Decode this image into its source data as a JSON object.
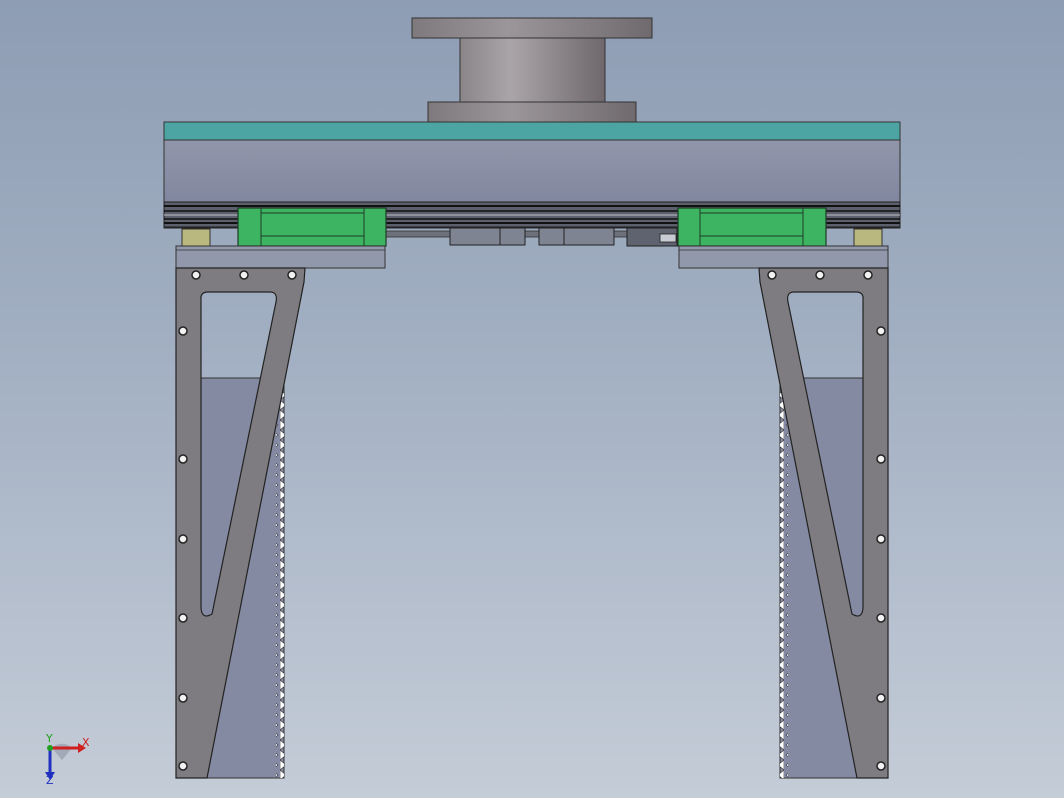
{
  "view": {
    "colors": {
      "background_top": "#8e9db4",
      "background_bottom": "#c4ccd7",
      "plate_teal": "#4da5a3",
      "plate_gray": "#8a90a6",
      "guide_block_green": "#3cb462",
      "shaft_gray": "#8e8a90",
      "arm_gray": "#7f7c81",
      "panel_blue_gray": "#848aa2",
      "spacer_olive": "#b9b87f"
    }
  },
  "triad": {
    "x_label": "X",
    "y_label": "Y",
    "z_label": "Z"
  }
}
